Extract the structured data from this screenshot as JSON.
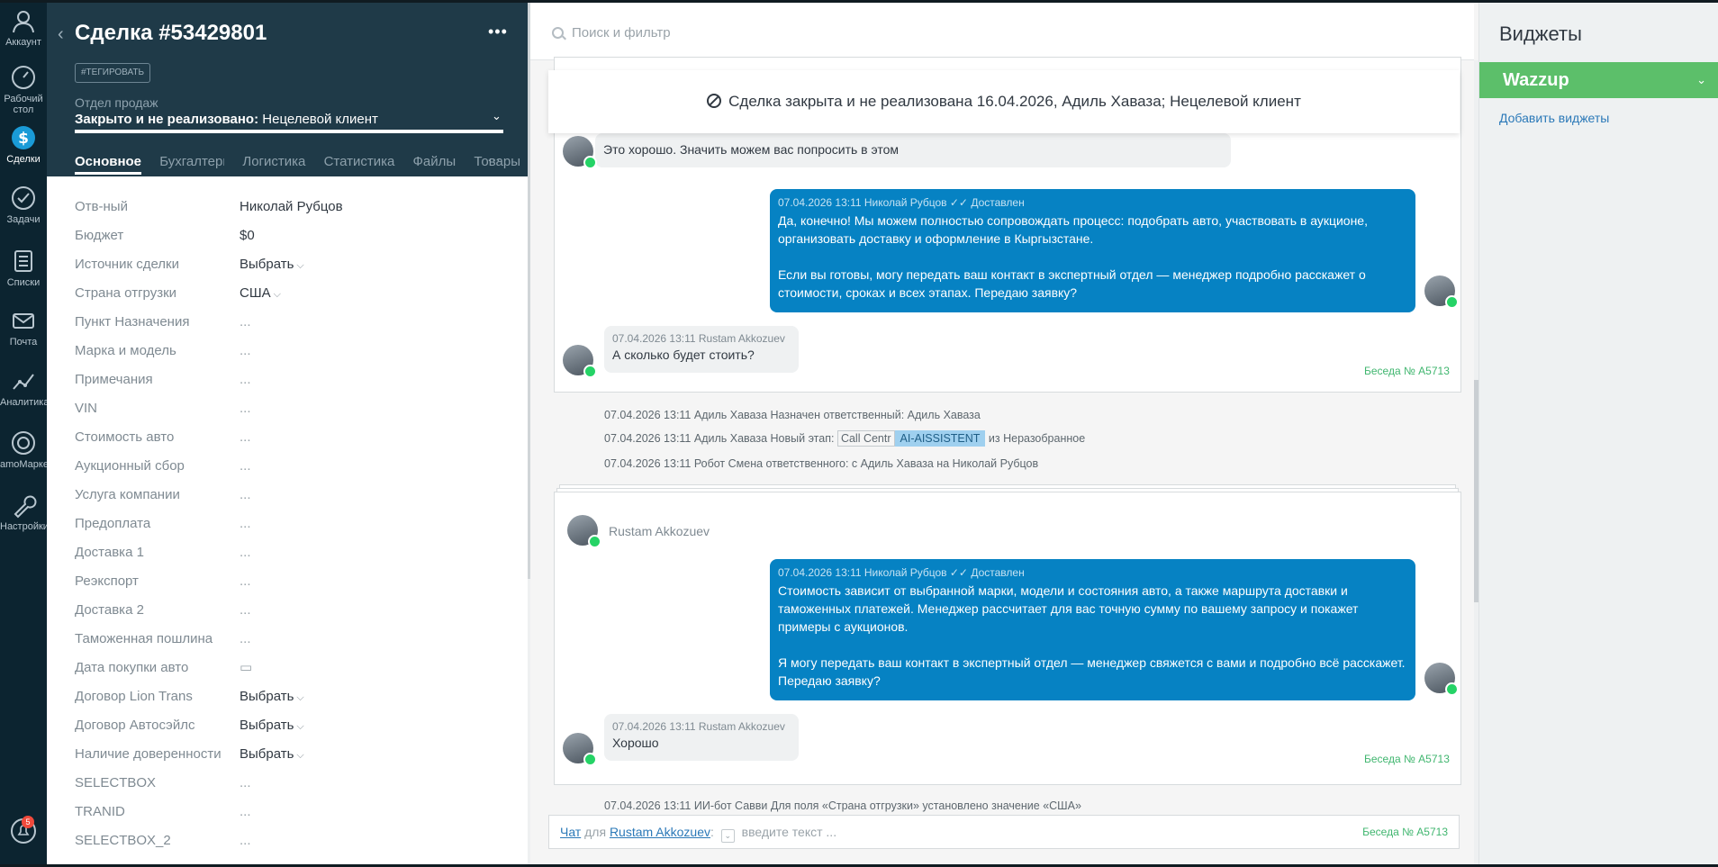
{
  "nav": {
    "items": [
      {
        "label": "Аккаунт"
      },
      {
        "label": "Рабочий стол"
      },
      {
        "label": "Сделки"
      },
      {
        "label": "Задачи"
      },
      {
        "label": "Списки"
      },
      {
        "label": "Почта"
      },
      {
        "label": "Аналитика"
      },
      {
        "label": "amoМаркет"
      },
      {
        "label": "Настройки"
      }
    ],
    "notifications_count": "5"
  },
  "card": {
    "title": "Сделка #53429801",
    "tag_button": "#ТЕГИРОВАТЬ",
    "pipeline": "Отдел продаж",
    "status_prefix": "Закрыто и не реализовано:",
    "status_value": "Нецелевой клиент",
    "tabs": [
      "Основное",
      "Бухгалтерия",
      "Логистика",
      "Статистика",
      "Файлы",
      "Товары"
    ],
    "fields": [
      {
        "label": "Отв-ный",
        "value": "Николай Рубцов",
        "kind": "text"
      },
      {
        "label": "Бюджет",
        "value": "$0",
        "kind": "text"
      },
      {
        "label": "Источник сделки",
        "value": "Выбрать",
        "kind": "select"
      },
      {
        "label": "Страна отгрузки",
        "value": "США",
        "kind": "select"
      },
      {
        "label": "Пункт Назначения",
        "value": "...",
        "kind": "empty"
      },
      {
        "label": "Марка и модель",
        "value": "...",
        "kind": "empty"
      },
      {
        "label": "Примечания",
        "value": "...",
        "kind": "empty"
      },
      {
        "label": "VIN",
        "value": "...",
        "kind": "empty"
      },
      {
        "label": "Стоимость авто",
        "value": "...",
        "kind": "empty"
      },
      {
        "label": "Аукционный сбор",
        "value": "...",
        "kind": "empty"
      },
      {
        "label": "Услуга компании",
        "value": "...",
        "kind": "empty"
      },
      {
        "label": "Предоплата",
        "value": "...",
        "kind": "empty"
      },
      {
        "label": "Доставка 1",
        "value": "...",
        "kind": "empty"
      },
      {
        "label": "Реэкспорт",
        "value": "...",
        "kind": "empty"
      },
      {
        "label": "Доставка 2",
        "value": "...",
        "kind": "empty"
      },
      {
        "label": "Таможенная пошлина",
        "value": "...",
        "kind": "empty"
      },
      {
        "label": "Дата покупки авто",
        "value": "▭",
        "kind": "empty"
      },
      {
        "label": "Договор Lion Trans",
        "value": "Выбрать",
        "kind": "select"
      },
      {
        "label": "Договор Автосэйлс",
        "value": "Выбрать",
        "kind": "select"
      },
      {
        "label": "Наличие доверенности",
        "value": "Выбрать",
        "kind": "select"
      },
      {
        "label": "SELECTBOX",
        "value": "...",
        "kind": "empty"
      },
      {
        "label": "TRANID",
        "value": "...",
        "kind": "empty"
      },
      {
        "label": "SELECTBOX_2",
        "value": "...",
        "kind": "empty"
      }
    ]
  },
  "feed": {
    "search_placeholder": "Поиск и фильтр",
    "closed_banner": "Сделка закрыта и не реализована 16.04.2026, Адиль Хаваза; Нецелевой клиент",
    "chat1": {
      "msg_in_1": "Это хорошо. Значить можем вас попросить в этом",
      "msg_out_meta": "07.04.2026 13:11 Николай Рубцов ✓✓ Доставлен",
      "msg_out_p1": "Да, конечно! Мы можем полностью сопровождать процесс: подобрать авто, участвовать в аукционе, организовать доставку и оформление в Кыргызстане.",
      "msg_out_p2": "Если вы готовы, могу передать ваш контакт в экспертный отдел — менеджер подробно расскажет о стоимости, сроках и всех этапах. Передаю заявку?",
      "msg_in_2_meta": "07.04.2026 13:11 Rustam Akkozuev",
      "msg_in_2": "А сколько будет стоить?",
      "conversation": "Беседа № A5713"
    },
    "system": {
      "line1": "07.04.2026 13:11 Адиль Хаваза Назначен ответственный: Адиль Хаваза",
      "line2_prefix": "07.04.2026 13:11 Адиль Хаваза Новый этап:",
      "line2_stage_from": "Call Centr",
      "line2_stage_to": "AI-AISSISTENT",
      "line2_suffix": "из Неразобранное",
      "line3": "07.04.2026 13:11 Робот Смена ответственного: с Адиль Хаваза на Николай Рубцов"
    },
    "chat2": {
      "sender": "Rustam Akkozuev",
      "msg_out_meta": "07.04.2026 13:11 Николай Рубцов ✓✓ Доставлен",
      "msg_out_p1": "Стоимость зависит от выбранной марки, модели и состояния авто, а также маршрута доставки и таможенных платежей. Менеджер рассчитает для вас точную сумму по вашему запросу и покажет примеры с аукционов.",
      "msg_out_p2": "Я могу передать ваш контакт в экспертный отдел — менеджер свяжется с вами и подробно всё расскажет. Передаю заявку?",
      "msg_in_meta": "07.04.2026 13:11 Rustam Akkozuev",
      "msg_in": "Хорошо",
      "conversation": "Беседа № A5713"
    },
    "system2": "07.04.2026 13:11 ИИ-бот Савви Для поля «Страна отгрузки» установлено значение «США»",
    "composer": {
      "chat_link": "Чат",
      "for_word": "для",
      "contact": "Rustam Akkozuev",
      "placeholder": "введите текст ...",
      "conversation": "Беседа № A5713"
    }
  },
  "widgets": {
    "title": "Виджеты",
    "wazzup": "Wazzup",
    "add": "Добавить виджеты"
  },
  "colors": {
    "nav_bg": "#0c2430",
    "card_head": "#1f3a48",
    "bubble_out": "#0682c3",
    "wazzup": "#5cbf6a",
    "link": "#2b79b8",
    "conversation": "#40b66f"
  }
}
